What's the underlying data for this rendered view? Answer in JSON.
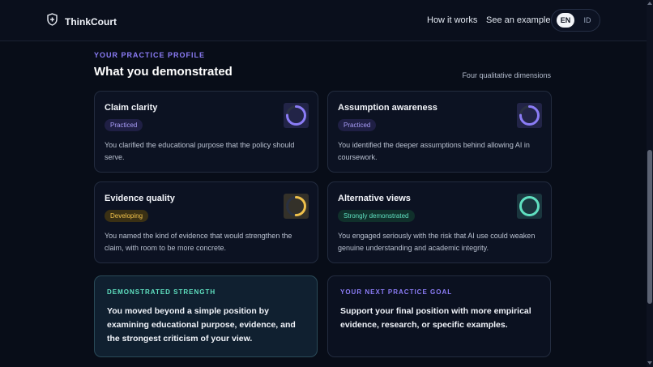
{
  "header": {
    "brand_name": "ThinkCourt",
    "brand_icon": "shield-plus-icon",
    "nav": {
      "how_it_works": "How it works",
      "see_example": "See an example"
    },
    "language": {
      "options": [
        "EN",
        "ID"
      ],
      "selected": "EN"
    }
  },
  "profile": {
    "eyebrow": "YOUR PRACTICE PROFILE",
    "title": "What you demonstrated",
    "note": "Four qualitative dimensions"
  },
  "dimensions": [
    {
      "title": "Claim clarity",
      "badge": "Practiced",
      "description": "You clarified the educational purpose that the policy should serve.",
      "level": 0.75,
      "color": "#8b7cf6"
    },
    {
      "title": "Assumption awareness",
      "badge": "Practiced",
      "description": "You identified the deeper assumptions behind allowing AI in coursework.",
      "level": 0.75,
      "color": "#8b7cf6"
    },
    {
      "title": "Evidence quality",
      "badge": "Developing",
      "description": "You named the kind of evidence that would strengthen the claim, with room to be more concrete.",
      "level": 0.5,
      "color": "#f0c14b"
    },
    {
      "title": "Alternative views",
      "badge": "Strongly demonstrated",
      "description": "You engaged seriously with the risk that AI use could weaken genuine understanding and academic integrity.",
      "level": 1.0,
      "color": "#5fe0c0"
    }
  ],
  "strength": {
    "eyebrow": "DEMONSTRATED STRENGTH",
    "text": "You moved beyond a simple position by examining educational purpose, evidence, and the strongest criticism of your view."
  },
  "goal": {
    "eyebrow": "YOUR NEXT PRACTICE GOAL",
    "text": "Support your final position with more empirical evidence, research, or specific examples."
  }
}
